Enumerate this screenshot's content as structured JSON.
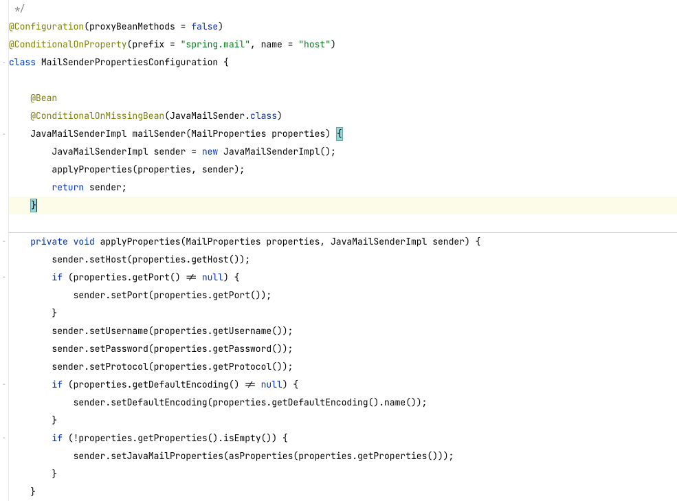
{
  "lines": [
    {
      "tokens": [
        {
          "t": " */",
          "c": "comment"
        }
      ]
    },
    {
      "tokens": [
        {
          "t": "@Configuration",
          "c": "annotation"
        },
        {
          "t": "(proxyBeanMethods = ",
          "c": ""
        },
        {
          "t": "false",
          "c": "keyword"
        },
        {
          "t": ")",
          "c": ""
        }
      ]
    },
    {
      "tokens": [
        {
          "t": "@ConditionalOnProperty",
          "c": "annotation"
        },
        {
          "t": "(prefix = ",
          "c": ""
        },
        {
          "t": "\"spring.mail\"",
          "c": "string"
        },
        {
          "t": ", name = ",
          "c": ""
        },
        {
          "t": "\"host\"",
          "c": "string"
        },
        {
          "t": ")",
          "c": ""
        }
      ]
    },
    {
      "tokens": [
        {
          "t": "class ",
          "c": "keyword"
        },
        {
          "t": "MailSenderPropertiesConfiguration {",
          "c": ""
        }
      ]
    },
    {
      "tokens": [
        {
          "t": "",
          "c": ""
        }
      ]
    },
    {
      "tokens": [
        {
          "t": "    ",
          "c": ""
        },
        {
          "t": "@Bean",
          "c": "annotation"
        }
      ]
    },
    {
      "tokens": [
        {
          "t": "    ",
          "c": ""
        },
        {
          "t": "@ConditionalOnMissingBean",
          "c": "annotation"
        },
        {
          "t": "(JavaMailSender.",
          "c": ""
        },
        {
          "t": "class",
          "c": "keyword"
        },
        {
          "t": ")",
          "c": ""
        }
      ]
    },
    {
      "tokens": [
        {
          "t": "    JavaMailSenderImpl mailSender(MailProperties properties) ",
          "c": ""
        },
        {
          "t": "{",
          "c": "brace-match"
        }
      ]
    },
    {
      "tokens": [
        {
          "t": "        JavaMailSenderImpl sender = ",
          "c": ""
        },
        {
          "t": "new ",
          "c": "keyword"
        },
        {
          "t": "JavaMailSenderImpl();",
          "c": ""
        }
      ]
    },
    {
      "tokens": [
        {
          "t": "        applyProperties(properties, sender);",
          "c": ""
        }
      ]
    },
    {
      "tokens": [
        {
          "t": "        ",
          "c": ""
        },
        {
          "t": "return ",
          "c": "keyword"
        },
        {
          "t": "sender;",
          "c": ""
        }
      ]
    },
    {
      "highlight": true,
      "tokens": [
        {
          "t": "    ",
          "c": ""
        },
        {
          "t": "}",
          "c": "brace-match"
        },
        {
          "t": "",
          "c": "caret"
        }
      ]
    },
    {
      "tokens": [
        {
          "t": "",
          "c": ""
        }
      ]
    },
    {
      "separator": true,
      "tokens": [
        {
          "t": "    ",
          "c": ""
        },
        {
          "t": "private void ",
          "c": "keyword"
        },
        {
          "t": "applyProperties(MailProperties properties, JavaMailSenderImpl sender) {",
          "c": ""
        }
      ]
    },
    {
      "tokens": [
        {
          "t": "        sender.setHost(properties.getHost());",
          "c": ""
        }
      ]
    },
    {
      "tokens": [
        {
          "t": "        ",
          "c": ""
        },
        {
          "t": "if ",
          "c": "keyword"
        },
        {
          "t": "(properties.getPort() != ",
          "c": ""
        },
        {
          "t": "null",
          "c": "keyword"
        },
        {
          "t": ") {",
          "c": ""
        }
      ]
    },
    {
      "tokens": [
        {
          "t": "            sender.setPort(properties.getPort());",
          "c": ""
        }
      ]
    },
    {
      "tokens": [
        {
          "t": "        }",
          "c": ""
        }
      ]
    },
    {
      "tokens": [
        {
          "t": "        sender.setUsername(properties.getUsername());",
          "c": ""
        }
      ]
    },
    {
      "tokens": [
        {
          "t": "        sender.setPassword(properties.getPassword());",
          "c": ""
        }
      ]
    },
    {
      "tokens": [
        {
          "t": "        sender.setProtocol(properties.getProtocol());",
          "c": ""
        }
      ]
    },
    {
      "tokens": [
        {
          "t": "        ",
          "c": ""
        },
        {
          "t": "if ",
          "c": "keyword"
        },
        {
          "t": "(properties.getDefaultEncoding() != ",
          "c": ""
        },
        {
          "t": "null",
          "c": "keyword"
        },
        {
          "t": ") {",
          "c": ""
        }
      ]
    },
    {
      "tokens": [
        {
          "t": "            sender.setDefaultEncoding(properties.getDefaultEncoding().name());",
          "c": ""
        }
      ]
    },
    {
      "tokens": [
        {
          "t": "        }",
          "c": ""
        }
      ]
    },
    {
      "tokens": [
        {
          "t": "        ",
          "c": ""
        },
        {
          "t": "if ",
          "c": "keyword"
        },
        {
          "t": "(!properties.getProperties().isEmpty()) {",
          "c": ""
        }
      ]
    },
    {
      "tokens": [
        {
          "t": "            sender.setJavaMailProperties(asProperties(properties.getProperties()));",
          "c": ""
        }
      ]
    },
    {
      "tokens": [
        {
          "t": "        }",
          "c": ""
        }
      ]
    },
    {
      "tokens": [
        {
          "t": "    }",
          "c": ""
        }
      ]
    }
  ],
  "fold_marks": [
    3,
    7,
    13,
    15,
    21,
    24
  ]
}
